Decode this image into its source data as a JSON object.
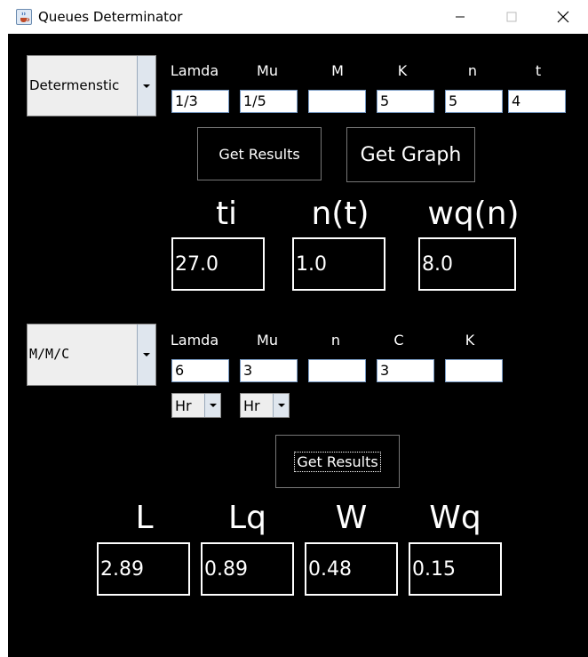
{
  "window": {
    "title": "Queues Determinator",
    "icon": "java-coffee-icon"
  },
  "top": {
    "model_select": "Determenstic",
    "labels": [
      "Lamda",
      "Mu",
      "M",
      "K",
      "n",
      "t"
    ],
    "values": [
      "1/3",
      "1/5",
      "",
      "5",
      "5",
      "4"
    ],
    "get_results_label": "Get Results",
    "get_graph_label": "Get Graph",
    "result_labels": [
      "ti",
      "n(t)",
      "wq(n)"
    ],
    "result_values": [
      "27.0",
      "1.0",
      "8.0"
    ]
  },
  "bottom": {
    "model_select": "M/M/C",
    "labels": [
      "Lamda",
      "Mu",
      "n",
      "C",
      "K"
    ],
    "values": [
      "6",
      "3",
      "",
      "3",
      ""
    ],
    "unit_lamda": "Hr",
    "unit_mu": "Hr",
    "get_results_label": "Get Results",
    "result_labels": [
      "L",
      "Lq",
      "W",
      "Wq"
    ],
    "result_values": [
      "2.89",
      "0.89",
      "0.48",
      "0.15"
    ]
  }
}
